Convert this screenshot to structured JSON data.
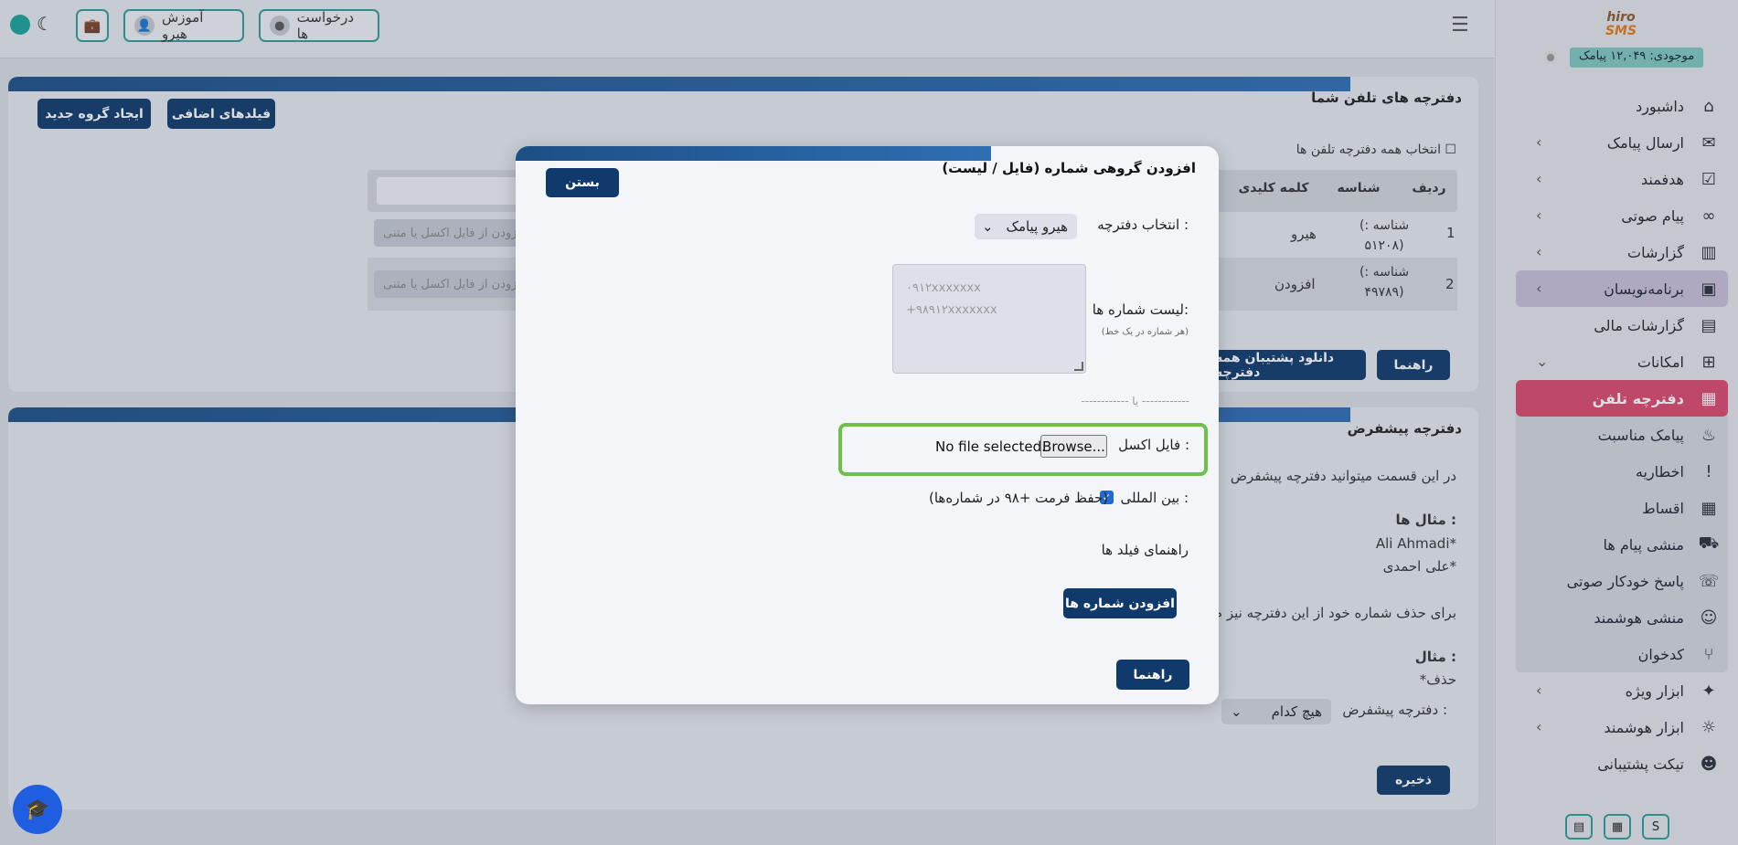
{
  "colors": {
    "accent": "#0f3a6b",
    "active": "#d9496e",
    "teal": "#2f9c95",
    "highlight_green": "#6cc04a"
  },
  "topbar": {
    "requests_label": "درخواست ها",
    "training_label": "آموزش هیرو",
    "icons": [
      "menu-icon",
      "briefcase-icon",
      "user-icon",
      "moon-icon"
    ]
  },
  "sidebar": {
    "logo_top": "hiro",
    "logo_bottom": "SMS",
    "credit": "موجودی: ۱۲,۰۴۹ پیامک",
    "items": [
      {
        "label": "داشبورد",
        "icon": "home-icon",
        "chevron": false
      },
      {
        "label": "ارسال پیامک",
        "icon": "sms-icon",
        "chevron": true
      },
      {
        "label": "هدفمند",
        "icon": "target-icon",
        "chevron": true
      },
      {
        "label": "پیام صوتی",
        "icon": "voicemail-icon",
        "chevron": true
      },
      {
        "label": "گزارشات",
        "icon": "reports-icon",
        "chevron": true
      },
      {
        "label": "برنامه‌نویسان",
        "icon": "code-icon",
        "chevron": true
      },
      {
        "label": "گزارشات مالی",
        "icon": "finance-icon",
        "chevron": false
      },
      {
        "label": "امکانات",
        "icon": "features-icon",
        "chevron": true
      },
      {
        "label": "دفترچه تلفن",
        "icon": "contacts-icon",
        "chevron": false
      },
      {
        "label": "پیامک مناسبت",
        "icon": "cake-icon",
        "chevron": false
      },
      {
        "label": "اخطاریه",
        "icon": "alert-icon",
        "chevron": false
      },
      {
        "label": "اقساط",
        "icon": "calendar-icon",
        "chevron": false
      },
      {
        "label": "منشی پیام ها",
        "icon": "truck-icon",
        "chevron": false
      },
      {
        "label": "پاسخ خودکار صوتی",
        "icon": "phone-icon",
        "chevron": false
      },
      {
        "label": "منشی هوشمند",
        "icon": "bot-icon",
        "chevron": false
      },
      {
        "label": "کدخوان",
        "icon": "branch-icon",
        "chevron": false
      },
      {
        "label": "ابزار ویژه",
        "icon": "sparkle-icon",
        "chevron": true
      },
      {
        "label": "ابزار هوشمند",
        "icon": "bulb-icon",
        "chevron": true
      },
      {
        "label": "تیکت پشتیبانی",
        "icon": "support-icon",
        "chevron": false
      }
    ],
    "bottom_buttons": [
      "S"
    ]
  },
  "phonebooks": {
    "title": "دفترچه های تلفن شما",
    "new_group": "ایجاد گروه جدید",
    "extra_fields": "فیلدهای اضافی",
    "select_all": "انتخاب همه دفترچه تلفن ها",
    "headers": [
      "ردیف",
      "شناسه",
      "کلمه کلیدی"
    ],
    "rows": [
      {
        "index": "1",
        "id": "(شناسه : ۵۱۲۰۸)",
        "name": "هیرو",
        "action": "افزودن از فایل اکسل یا متنی"
      },
      {
        "index": "2",
        "id": "(شناسه : ۴۹۷۸۹)",
        "name": "افزودن",
        "action": "افزودن از فایل اکسل یا متنی"
      }
    ],
    "guide": "راهنما",
    "download_backup": "دانلود پشتیبان همه دفترچه"
  },
  "default_book": {
    "title": "دفترچه پیشفرض",
    "intro": "در این قسمت میتوانید دفترچه پیشفرض",
    "example_title": "مثال ها :",
    "examples": [
      "Ali Ahmadi*",
      "علی احمدی*"
    ],
    "delete_text": "برای حذف شماره خود از این دفترچه نیز م",
    "example2_title": "مثال :",
    "example2": "*حذف",
    "default_label": "دفترچه پیشفرض :",
    "default_value": "هیچ کدام",
    "save": "ذخیره"
  },
  "modal": {
    "title": "افزودن گروهی شماره (فایل / لیست)",
    "close": "بستن",
    "select_label": "انتخاب دفترچه :",
    "select_value": "هیرو پیامک",
    "list_label": "لیست شماره ها:",
    "list_hint": "(هر شماره در یک خط)",
    "placeholder_line1": "۰۹۱۲xxxxxxx",
    "placeholder_line2": "+۹۸۹۱۲xxxxxxx",
    "or": "------------ یا ------------",
    "excel_label": "فایل اکسل :",
    "browse": "Browse...",
    "no_file": "No file selected.",
    "intl_label": "بین المللی :",
    "intl_note": "(حفظ فرمت +۹۸ در شماره‌ها)",
    "fields_guide": "راهنمای فیلد ها",
    "add_numbers": "افزودن شماره ها",
    "help": "راهنما"
  }
}
